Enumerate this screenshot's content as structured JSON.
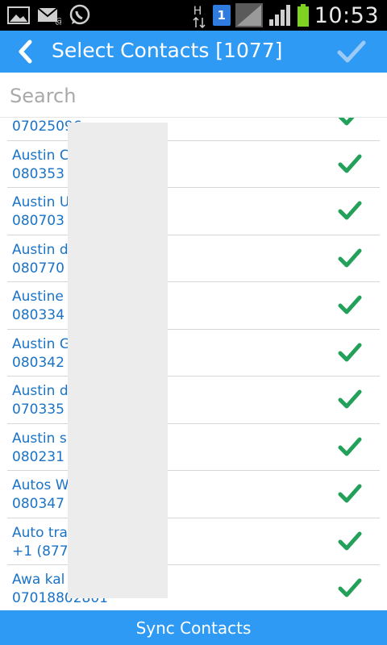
{
  "status_bar": {
    "time": "10:53",
    "icons": [
      "gallery-icon",
      "email-icon",
      "whatsapp-icon",
      "data-transfer-icon",
      "sim-icon",
      "signal-icon",
      "battery-icon"
    ],
    "network_label": "H",
    "sim_number": "1"
  },
  "header": {
    "title": "Select Contacts [1077]",
    "back_icon": "chevron-left-icon",
    "done_icon": "checkmark-icon"
  },
  "search": {
    "placeholder": "Search",
    "value": ""
  },
  "contacts": [
    {
      "name": "",
      "phone": "07025096..."
    },
    {
      "name": "Austin C",
      "phone": "080353"
    },
    {
      "name": "Austin U",
      "phone": "080703"
    },
    {
      "name": "Austin d",
      "phone": "080770"
    },
    {
      "name": "Austine",
      "phone": "080334"
    },
    {
      "name": "Austin G",
      "phone": "080342"
    },
    {
      "name": "Austin d",
      "phone": "070335"
    },
    {
      "name": "Austin s",
      "phone": "080231"
    },
    {
      "name": "Autos W",
      "phone": "080347"
    },
    {
      "name": "Auto tra",
      "phone": "+1 (877)"
    },
    {
      "name": "Awa kal",
      "phone": "07018802801"
    }
  ],
  "colors": {
    "accent": "#2e9af4",
    "text_link": "#1a73c7",
    "check_green": "#23a05a"
  },
  "footer": {
    "sync_label": "Sync Contacts"
  }
}
